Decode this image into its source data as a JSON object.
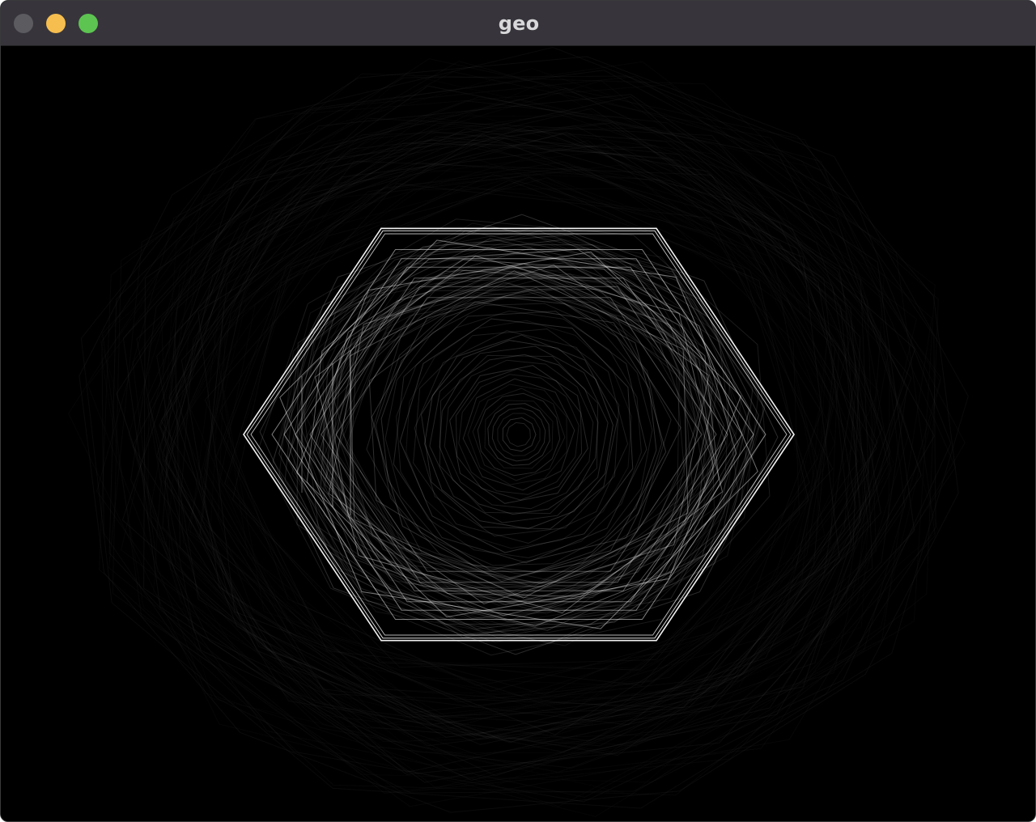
{
  "window": {
    "title": "geo",
    "controls": {
      "close": {
        "icon": "close-icon",
        "color": "#5c5b60"
      },
      "minimize": {
        "icon": "minimize-icon",
        "color": "#f6be4f"
      },
      "zoom": {
        "icon": "zoom-icon",
        "color": "#5dc451"
      }
    }
  },
  "canvas": {
    "background": "#000000",
    "stroke_color": "#ffffff",
    "shape_sides": 6
  }
}
